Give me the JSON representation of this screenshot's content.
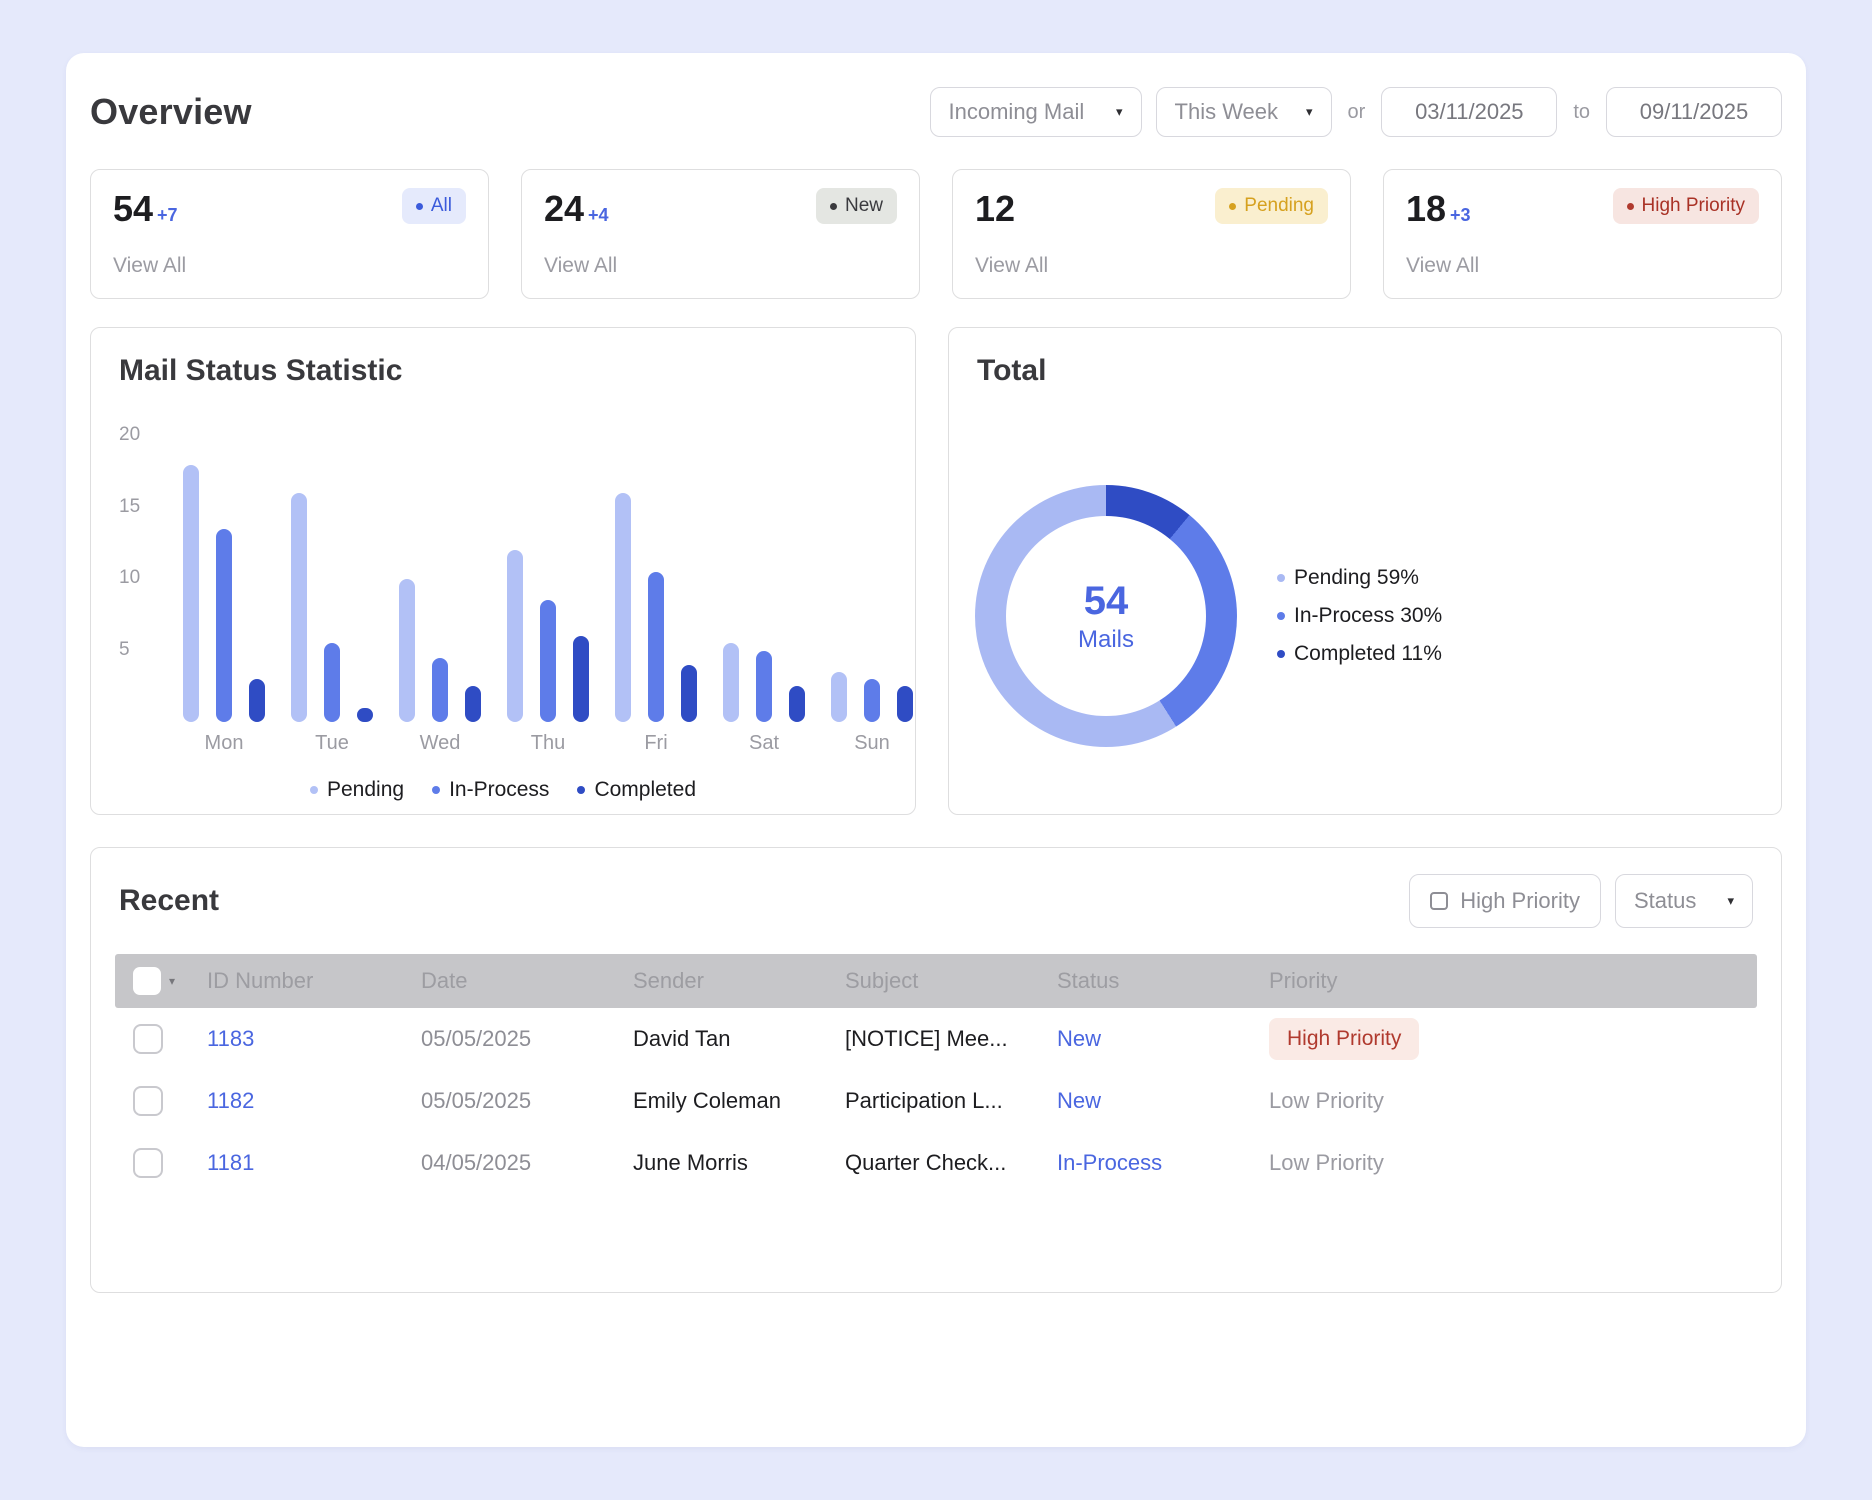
{
  "page": {
    "title": "Overview"
  },
  "filters": {
    "mail_type": "Incoming Mail",
    "period": "This Week",
    "or_label": "or",
    "date_from": "03/11/2025",
    "to_label": "to",
    "date_to": "09/11/2025",
    "caret_icon": "▾"
  },
  "stat_cards": [
    {
      "value": "54",
      "delta": "+7",
      "badge": "All",
      "badge_style": "all",
      "link": "View All"
    },
    {
      "value": "24",
      "delta": "+4",
      "badge": "New",
      "badge_style": "new",
      "link": "View All"
    },
    {
      "value": "12",
      "delta": "",
      "badge": "Pending",
      "badge_style": "pending",
      "link": "View All"
    },
    {
      "value": "18",
      "delta": "+3",
      "badge": "High Priority",
      "badge_style": "high",
      "link": "View All"
    }
  ],
  "chart_data": [
    {
      "type": "bar",
      "title": "Mail Status Statistic",
      "categories": [
        "Mon",
        "Tue",
        "Wed",
        "Thu",
        "Fri",
        "Sat",
        "Sun"
      ],
      "series": [
        {
          "name": "Pending",
          "color": "#b2c1f6",
          "values": [
            18,
            16,
            10,
            12,
            16,
            5.5,
            3.5
          ]
        },
        {
          "name": "In-Process",
          "color": "#5e7ce9",
          "values": [
            13.5,
            5.5,
            4.5,
            8.5,
            10.5,
            5,
            3
          ]
        },
        {
          "name": "Completed",
          "color": "#2f4cc4",
          "values": [
            3,
            1,
            2.5,
            6,
            4,
            2.5,
            2.5
          ]
        }
      ],
      "ylim": [
        0,
        20
      ],
      "yticks": [
        5,
        10,
        15,
        20
      ],
      "legend_position": "bottom",
      "grid": false
    },
    {
      "type": "pie",
      "title": "Total",
      "center_value": "54",
      "center_label": "Mails",
      "slices": [
        {
          "label": "Pending",
          "pct": 59,
          "color": "#a9b9f3"
        },
        {
          "label": "In-Process",
          "pct": 30,
          "color": "#5e7ce9"
        },
        {
          "label": "Completed",
          "pct": 11,
          "color": "#2f4cc4"
        }
      ]
    }
  ],
  "recent": {
    "title": "Recent",
    "high_priority_filter": "High Priority",
    "status_filter": "Status",
    "columns": [
      "ID Number",
      "Date",
      "Sender",
      "Subject",
      "Status",
      "Priority"
    ],
    "rows": [
      {
        "id": "1183",
        "date": "05/05/2025",
        "sender": "David Tan",
        "subject": "[NOTICE] Mee...",
        "status": "New",
        "priority": "High Priority",
        "priority_style": "high"
      },
      {
        "id": "1182",
        "date": "05/05/2025",
        "sender": "Emily Coleman",
        "subject": "Participation L...",
        "status": "New",
        "priority": "Low Priority",
        "priority_style": "low"
      },
      {
        "id": "1181",
        "date": "04/05/2025",
        "sender": "June Morris",
        "subject": "Quarter Check...",
        "status": "In-Process",
        "priority": "Low Priority",
        "priority_style": "low"
      }
    ]
  }
}
